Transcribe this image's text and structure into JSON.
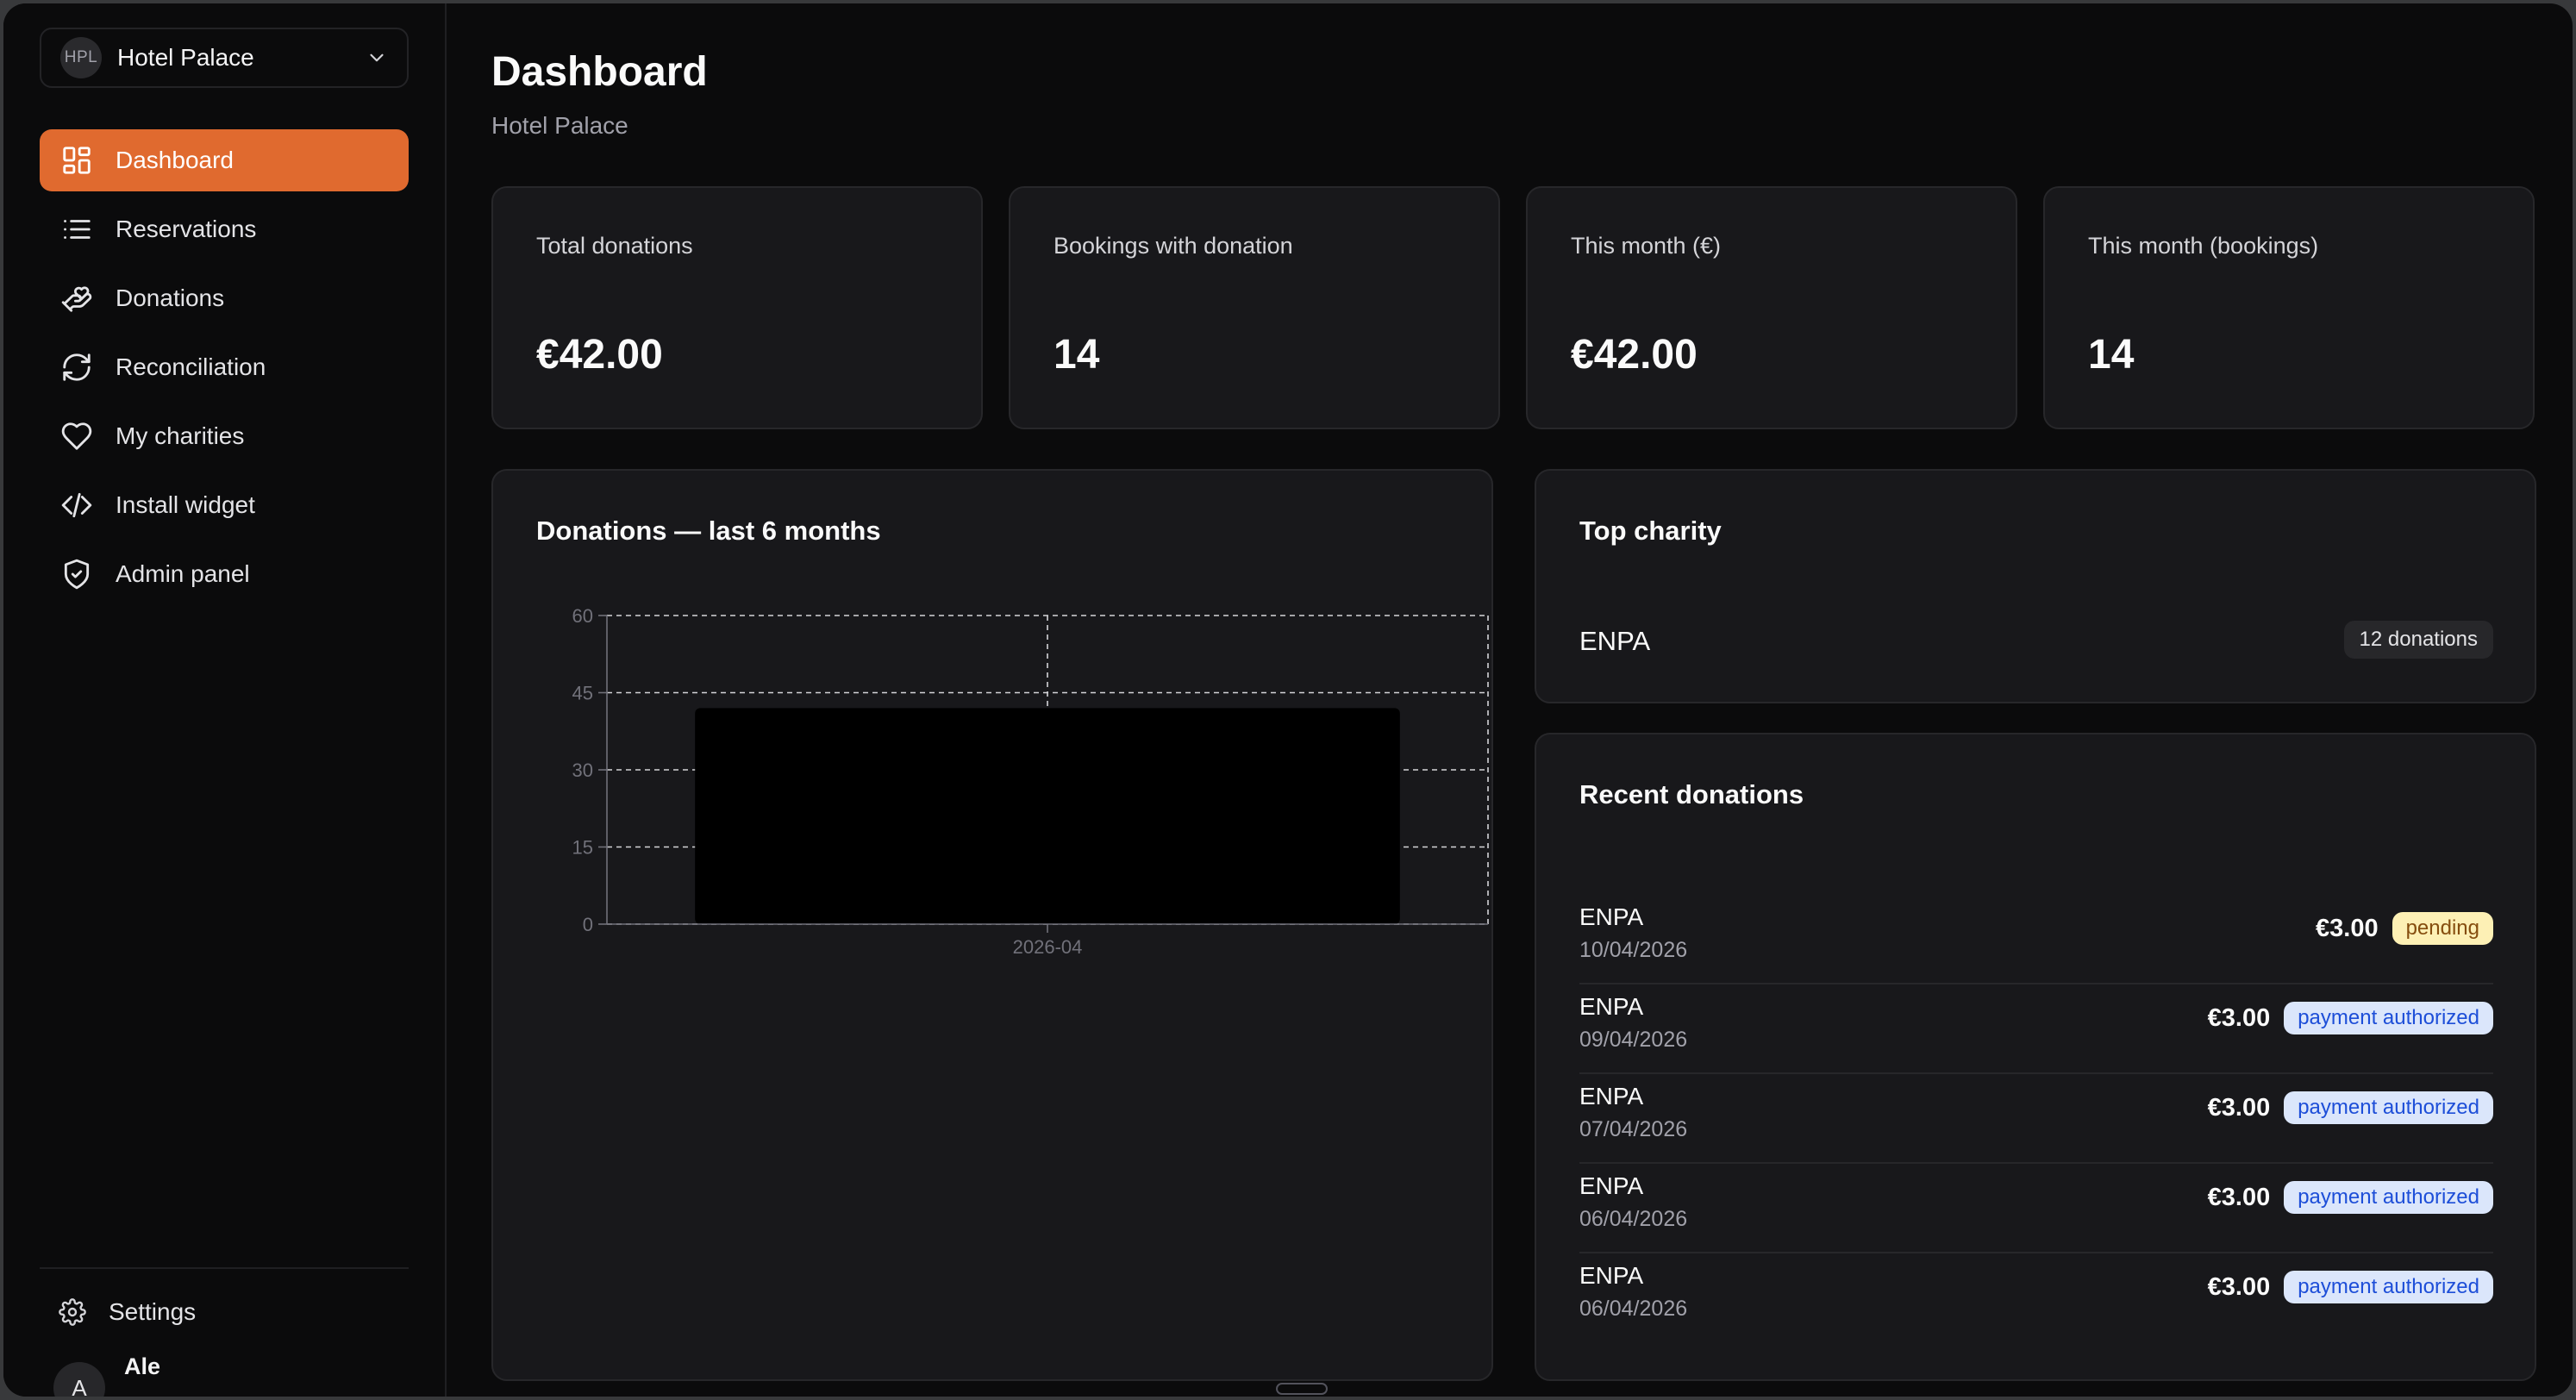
{
  "sidebar": {
    "hotel": {
      "initials": "HPL",
      "name": "Hotel Palace"
    },
    "items": [
      {
        "label": "Dashboard",
        "icon": "dashboard-icon",
        "active": true
      },
      {
        "label": "Reservations",
        "icon": "list-icon"
      },
      {
        "label": "Donations",
        "icon": "hand-heart-icon"
      },
      {
        "label": "Reconciliation",
        "icon": "refresh-icon"
      },
      {
        "label": "My charities",
        "icon": "heart-icon"
      },
      {
        "label": "Install widget",
        "icon": "code-icon"
      },
      {
        "label": "Admin panel",
        "icon": "shield-check-icon"
      }
    ],
    "settings_label": "Settings",
    "user": {
      "initial": "A",
      "name": "Ale"
    }
  },
  "header": {
    "title": "Dashboard",
    "subtitle": "Hotel Palace"
  },
  "stats": [
    {
      "label": "Total donations",
      "value": "€42.00"
    },
    {
      "label": "Bookings with donation",
      "value": "14"
    },
    {
      "label": "This month (€)",
      "value": "€42.00"
    },
    {
      "label": "This month (bookings)",
      "value": "14"
    }
  ],
  "chart_card": {
    "title": "Donations — last 6 months"
  },
  "chart_data": {
    "type": "bar",
    "title": "Donations — last 6 months",
    "categories": [
      "2026-04"
    ],
    "values": [
      42
    ],
    "ylim": [
      0,
      60
    ],
    "yticks": [
      0,
      15,
      30,
      45,
      60
    ],
    "grid": true,
    "bar_color": "#000000"
  },
  "top_charity": {
    "title": "Top charity",
    "name": "ENPA",
    "count_label": "12 donations"
  },
  "recent": {
    "title": "Recent donations",
    "rows": [
      {
        "name": "ENPA",
        "date": "10/04/2026",
        "amount": "€3.00",
        "status": "pending",
        "kind": "pending"
      },
      {
        "name": "ENPA",
        "date": "09/04/2026",
        "amount": "€3.00",
        "status": "payment authorized",
        "kind": "authorized"
      },
      {
        "name": "ENPA",
        "date": "07/04/2026",
        "amount": "€3.00",
        "status": "payment authorized",
        "kind": "authorized"
      },
      {
        "name": "ENPA",
        "date": "06/04/2026",
        "amount": "€3.00",
        "status": "payment authorized",
        "kind": "authorized"
      },
      {
        "name": "ENPA",
        "date": "06/04/2026",
        "amount": "€3.00",
        "status": "payment authorized",
        "kind": "authorized"
      }
    ]
  },
  "colors": {
    "accent": "#e06a2f",
    "pending_bg": "#fdf0b5",
    "authorized_bg": "#dbe6fb"
  }
}
